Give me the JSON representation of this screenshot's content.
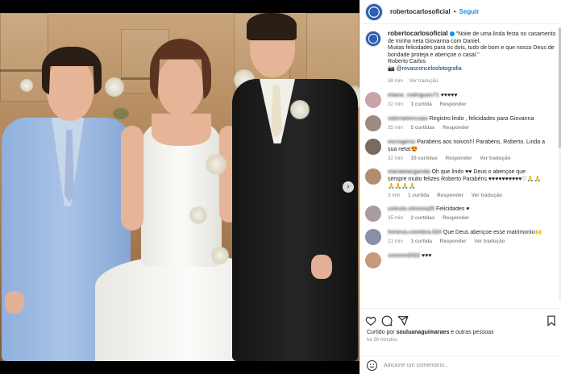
{
  "post": {
    "username": "robertocarlosoficial",
    "verified_icon": "verified-badge-icon",
    "follow_label": "Seguir",
    "separator": "•",
    "caption": {
      "username": "robertocarlosoficial",
      "verified_icon": "verified-badge-icon",
      "text_line1": "\"Noite de uma linda festa no casamento de minha neta Giovanna com Daniel.",
      "text_line2": "Muitas felicidades para os dois, tudo de bom e que nosso Deus de bondade proteja e abençoe o casal.\"",
      "signature": "Roberto Carlos",
      "camera_emoji": "📷",
      "photo_credit": "@revasconcelosfotografia",
      "time": "38 min",
      "translation": "Ver tradução"
    },
    "comments": [
      {
        "user": "eliane_rodrigues71",
        "text": "♥♥♥♥♥",
        "time": "32 min",
        "likes": "1 curtida",
        "reply": "Responder",
        "translation": "",
        "avatar_color": "#c9a3a8"
      },
      {
        "user": "valeriamessias",
        "text": "Registro lindo , felicidades para Giovanna",
        "time": "35 min",
        "likes": "5 curtidas",
        "reply": "Responder",
        "translation": "",
        "avatar_color": "#9c8b7e"
      },
      {
        "user": "mcrogerio",
        "text": "Parabéns aos noivos!!! Parabéns, Roberto. Linda a sua neta!😍",
        "time": "32 min",
        "likes": "10 curtidas",
        "reply": "Responder",
        "translation": "Ver tradução",
        "avatar_color": "#7a6a60"
      },
      {
        "user": "mariamargarida",
        "text": "Oh que lindo ♥♥ Deus o abençoe que sempre muito felizes Roberto Parabéns ♥♥♥♥♥♥♥♥♥♥♡🙏🙏🙏🙏🙏🙏",
        "time": "3 min",
        "likes": "1 curtida",
        "reply": "Responder",
        "translation": "Ver tradução",
        "avatar_color": "#b08f6e"
      },
      {
        "user": "celeste.oliveira25",
        "text": "Felicidades ♥",
        "time": "35 min",
        "likes": "2 curtidas",
        "reply": "Responder",
        "translation": "",
        "avatar_color": "#a99ca0"
      },
      {
        "user": "heloisa.coimbra.524",
        "text": "Que Deus abençoe esse matrimonio🙌",
        "time": "21 min",
        "likes": "1 curtida",
        "reply": "Responder",
        "translation": "Ver tradução",
        "avatar_color": "#8a8fa6"
      },
      {
        "user": "simone2022",
        "text": "♥♥♥",
        "time": "",
        "likes": "",
        "reply": "",
        "translation": "",
        "avatar_color": "#c89a7b"
      }
    ],
    "liked_by_prefix": "Curtido por",
    "liked_by_user": "souluanaguimaraes",
    "liked_by_suffix": "e outras pessoas",
    "posted_ago": "há 38 minutos",
    "add_comment_placeholder": "Adicione um comentário...",
    "icons": [
      "heart-icon",
      "comment-icon",
      "share-icon",
      "bookmark-icon",
      "emoji-icon"
    ],
    "carousel_next": "›"
  },
  "colors": {
    "accent": "#0095f6",
    "heart": "#ed4956",
    "text": "#262626",
    "muted": "#8e8e8e"
  }
}
